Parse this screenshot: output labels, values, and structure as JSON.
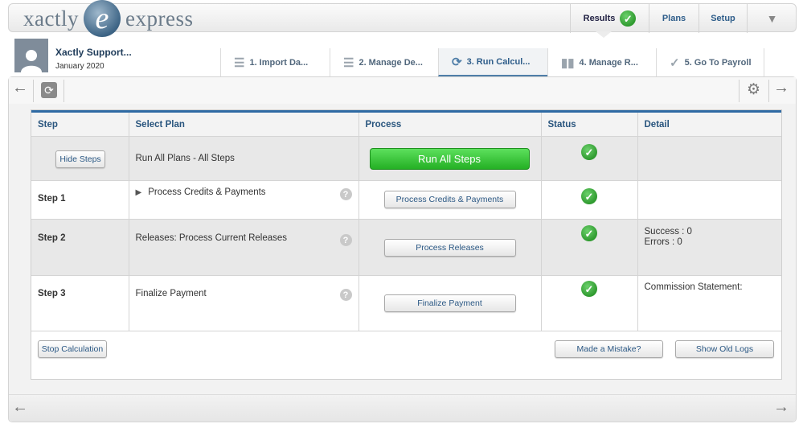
{
  "header": {
    "logo_left": "xactly",
    "logo_letter": "e",
    "logo_right": "express",
    "nav": {
      "results": "Results",
      "plans": "Plans",
      "setup": "Setup",
      "more_icon": "caret-down-icon"
    }
  },
  "user": {
    "name": "Xactly Support...",
    "period": "January 2020"
  },
  "tabs": [
    {
      "label": "1. Import Da...",
      "icon": "list-arrow-icon"
    },
    {
      "label": "2. Manage De...",
      "icon": "list-icon"
    },
    {
      "label": "3. Run Calcul...",
      "icon": "refresh-icon",
      "active": true
    },
    {
      "label": "4. Manage R...",
      "icon": "bar-chart-icon"
    },
    {
      "label": "5. Go To Payroll",
      "icon": "checkmark-icon"
    }
  ],
  "table": {
    "headers": {
      "step": "Step",
      "plan": "Select Plan",
      "process": "Process",
      "status": "Status",
      "detail": "Detail"
    },
    "all": {
      "step_button": "Hide Steps",
      "plan": "Run All Plans - All Steps",
      "process_button": "Run All Steps"
    },
    "rows": [
      {
        "step": "Step 1",
        "plan": "Process Credits & Payments",
        "process_button": "Process Credits & Payments",
        "detail": ""
      },
      {
        "step": "Step 2",
        "plan": "Releases: Process Current Releases",
        "process_button": "Process Releases",
        "detail_success": "Success :  0",
        "detail_errors": "Errors :  0"
      },
      {
        "step": "Step 3",
        "plan": "Finalize Payment",
        "process_button": "Finalize Payment",
        "detail": "Commission Statement:"
      }
    ]
  },
  "buttons": {
    "stop": "Stop Calculation",
    "mistake": "Made a Mistake?",
    "logs": "Show Old Logs"
  },
  "colors": {
    "accent": "#2e6aa3",
    "run_green": "#2fbf2f",
    "status_green": "#2f9a2f"
  }
}
